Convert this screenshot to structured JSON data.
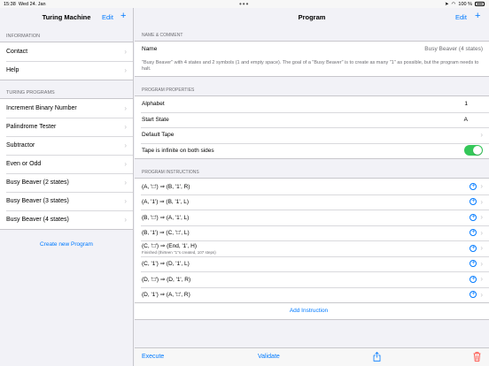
{
  "status": {
    "time": "15:38",
    "date": "Wed 24. Jan",
    "battery": "100 %"
  },
  "sidebar": {
    "title": "Turing Machine",
    "edit": "Edit",
    "add": "+",
    "info_header": "INFORMATION",
    "info_items": [
      "Contact",
      "Help"
    ],
    "programs_header": "TURING PROGRAMS",
    "programs": [
      "Increment Binary Number",
      "Palindrome Tester",
      "Subtractor",
      "Even or Odd",
      "Busy Beaver (2 states)",
      "Busy Beaver (3 states)",
      "Busy Beaver (4 states)"
    ],
    "create": "Create new Program"
  },
  "main": {
    "title": "Program",
    "edit": "Edit",
    "add": "+",
    "name_header": "NAME & COMMENT",
    "name_label": "Name",
    "name_value": "Busy Beaver (4 states)",
    "comment": "\"Busy Beaver\" with 4 states and 2 symbols (1 and empty space). The goal of a \"Busy Beaver\" is to create as many \"1\" as possible, but the program needs to halt.",
    "props_header": "PROGRAM PROPERTIES",
    "alphabet_label": "Alphabet",
    "alphabet_value": "1",
    "start_label": "Start State",
    "start_value": "A",
    "tape_label": "Default Tape",
    "infinite_label": "Tape is infinite on both sides",
    "infinite_on": true,
    "instr_header": "PROGRAM INSTRUCTIONS",
    "instructions": [
      {
        "text": "(A, '□') ⇒ (B, '1', R)",
        "sub": ""
      },
      {
        "text": "(A, '1') ⇒ (B, '1', L)",
        "sub": ""
      },
      {
        "text": "(B, '□') ⇒ (A, '1', L)",
        "sub": ""
      },
      {
        "text": "(B, '1') ⇒ (C, '□', L)",
        "sub": ""
      },
      {
        "text": "(C, '□') ⇒ (End, '1', H)",
        "sub": "Finished (thirteen \"1\"s created, 107 steps)"
      },
      {
        "text": "(C, '1') ⇒ (D, '1', L)",
        "sub": ""
      },
      {
        "text": "(D, '□') ⇒ (D, '1', R)",
        "sub": ""
      },
      {
        "text": "(D, '1') ⇒ (A, '□', R)",
        "sub": ""
      }
    ],
    "add_instruction": "Add Instruction",
    "toolbar": {
      "execute": "Execute",
      "validate": "Validate"
    }
  }
}
